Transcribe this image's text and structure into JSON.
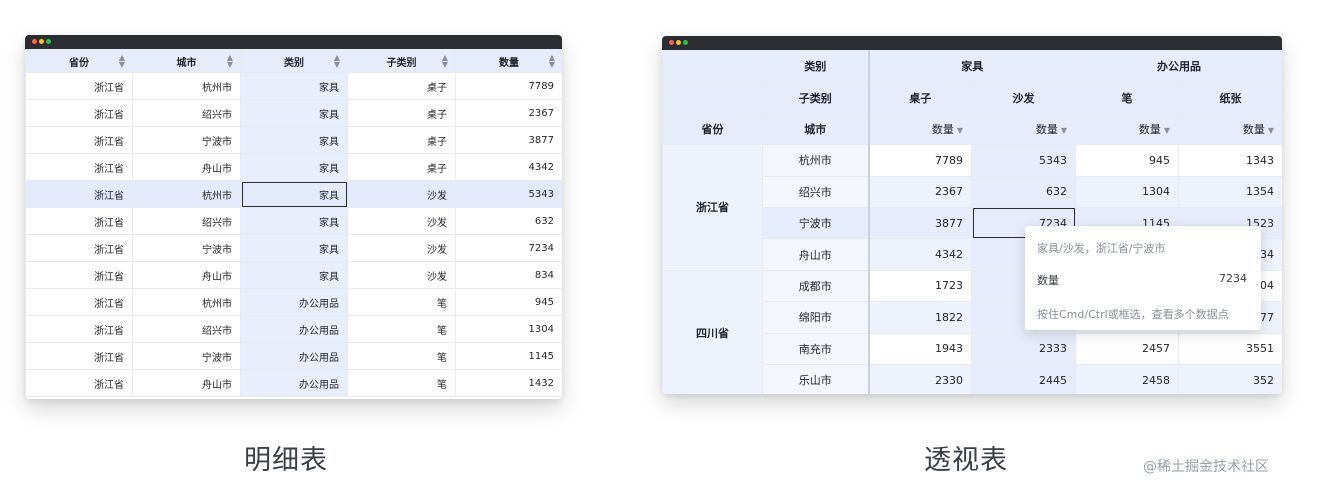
{
  "detail": {
    "headers": [
      "省份",
      "城市",
      "类别",
      "子类别",
      "数量"
    ],
    "rows": [
      [
        "浙江省",
        "杭州市",
        "家具",
        "桌子",
        "7789"
      ],
      [
        "浙江省",
        "绍兴市",
        "家具",
        "桌子",
        "2367"
      ],
      [
        "浙江省",
        "宁波市",
        "家具",
        "桌子",
        "3877"
      ],
      [
        "浙江省",
        "舟山市",
        "家具",
        "桌子",
        "4342"
      ],
      [
        "浙江省",
        "杭州市",
        "家具",
        "沙发",
        "5343"
      ],
      [
        "浙江省",
        "绍兴市",
        "家具",
        "沙发",
        "632"
      ],
      [
        "浙江省",
        "宁波市",
        "家具",
        "沙发",
        "7234"
      ],
      [
        "浙江省",
        "舟山市",
        "家具",
        "沙发",
        "834"
      ],
      [
        "浙江省",
        "杭州市",
        "办公用品",
        "笔",
        "945"
      ],
      [
        "浙江省",
        "绍兴市",
        "办公用品",
        "笔",
        "1304"
      ],
      [
        "浙江省",
        "宁波市",
        "办公用品",
        "笔",
        "1145"
      ],
      [
        "浙江省",
        "舟山市",
        "办公用品",
        "笔",
        "1432"
      ]
    ],
    "caption": "明细表"
  },
  "pivot": {
    "corner": {
      "category": "类别",
      "subcategory": "子类别",
      "province": "省份",
      "city": "城市"
    },
    "categories": [
      "家具",
      "办公用品"
    ],
    "subcategories": [
      "桌子",
      "沙发",
      "笔",
      "纸张"
    ],
    "measure": "数量",
    "provinces": [
      "浙江省",
      "四川省"
    ],
    "rows": [
      {
        "city": "杭州市",
        "values": [
          "7789",
          "5343",
          "945",
          "1343"
        ]
      },
      {
        "city": "绍兴市",
        "values": [
          "2367",
          "632",
          "1304",
          "1354"
        ]
      },
      {
        "city": "宁波市",
        "values": [
          "3877",
          "7234",
          "1145",
          "1523"
        ]
      },
      {
        "city": "舟山市",
        "values": [
          "4342",
          "",
          "",
          "34"
        ]
      },
      {
        "city": "成都市",
        "values": [
          "1723",
          "",
          "",
          "04"
        ]
      },
      {
        "city": "绵阳市",
        "values": [
          "1822",
          "",
          "",
          "77"
        ]
      },
      {
        "city": "南充市",
        "values": [
          "1943",
          "2333",
          "2457",
          "3551"
        ]
      },
      {
        "city": "乐山市",
        "values": [
          "2330",
          "2445",
          "2458",
          "352"
        ]
      }
    ],
    "caption": "透视表"
  },
  "tooltip": {
    "path": "家具/沙发，浙江省/宁波市",
    "measure_label": "数量",
    "measure_value": "7234",
    "hint": "按住Cmd/Ctrl或框选，查看多个数据点"
  },
  "watermark": "@稀土掘金技术社区",
  "icons": {
    "sort": "sort-updown-icon",
    "dropdown": "dropdown-triangle-icon"
  },
  "colors": {
    "header_bg": "#e6ecfb",
    "highlight_bg": "#e9eefc",
    "titlebar": "#2b2d30"
  }
}
